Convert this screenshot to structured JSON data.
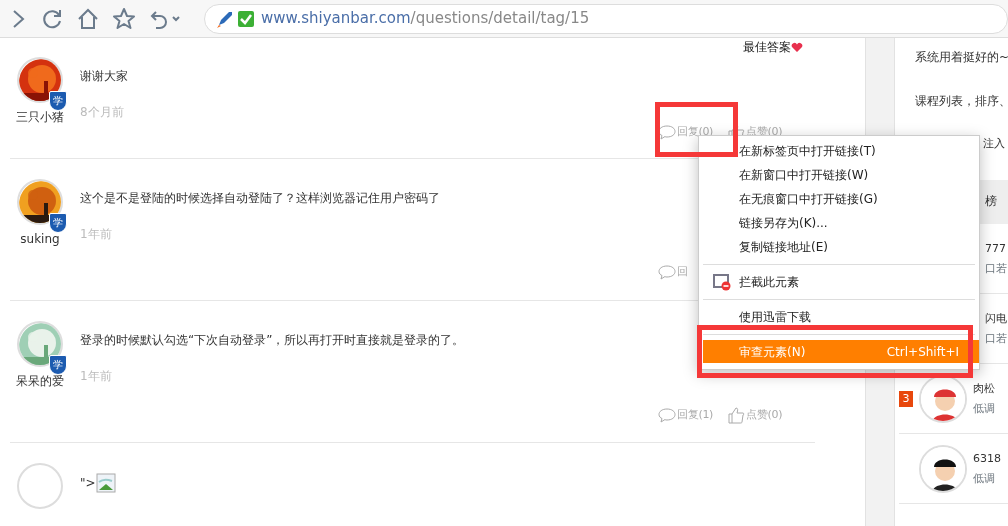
{
  "toolbar": {
    "url_host": "www.shiyanbar.com",
    "url_path": "/questions/detail/tag/15"
  },
  "best_answer": {
    "label": "最佳答案"
  },
  "posts": [
    {
      "author": "三只小猪",
      "badge": "学",
      "text": "谢谢大家",
      "time": "8个月前",
      "reply": "回复(0)",
      "like": "点赞(0)"
    },
    {
      "author": "suking",
      "badge": "学",
      "text": "这个是不是登陆的时候选择自动登陆了？这样浏览器记住用户密码了",
      "time": "1年前",
      "reply": "回"
    },
    {
      "author": "呆呆的爱",
      "badge": "学",
      "text": "登录的时候默认勾选“下次自动登录”，所以再打开时直接就是登录的了。",
      "time": "1年前",
      "reply": "回复(1)",
      "like": "点赞(0)"
    },
    {
      "kind": "broken",
      "text": "\">"
    }
  ],
  "sidebar": {
    "notes": [
      {
        "kind": "full",
        "text": "系统用着挺好的~"
      },
      {
        "kind": "full",
        "text": "课程列表，排序、"
      },
      {
        "kind": "covered",
        "text": "注入"
      }
    ],
    "header": "榜",
    "items": [
      {
        "kind": "covered",
        "name": "777",
        "subtitle": "口若"
      },
      {
        "kind": "covered",
        "name": "闪电",
        "subtitle": "口若"
      },
      {
        "kind": "full",
        "rank": "3",
        "name": "肉松",
        "subtitle": "低调"
      },
      {
        "kind": "full",
        "name": "6318",
        "subtitle": "低调"
      }
    ]
  },
  "context_menu": [
    {
      "kind": "item",
      "label": "在新标签页中打开链接(T)",
      "selected": false
    },
    {
      "kind": "item",
      "label": "在新窗口中打开链接(W)",
      "selected": false
    },
    {
      "kind": "item",
      "label": "在无痕窗口中打开链接(G)",
      "selected": false
    },
    {
      "kind": "item",
      "label": "链接另存为(K)...",
      "selected": false
    },
    {
      "kind": "item",
      "label": "复制链接地址(E)",
      "selected": false
    },
    {
      "kind": "divider"
    },
    {
      "kind": "block",
      "label": "拦截此元素",
      "selected": false
    },
    {
      "kind": "divider"
    },
    {
      "kind": "item",
      "label": "使用迅雷下载",
      "selected": false
    },
    {
      "kind": "divider"
    },
    {
      "kind": "item",
      "label": "审查元素(N)",
      "shortcut": "Ctrl+Shift+I",
      "selected": true
    }
  ]
}
